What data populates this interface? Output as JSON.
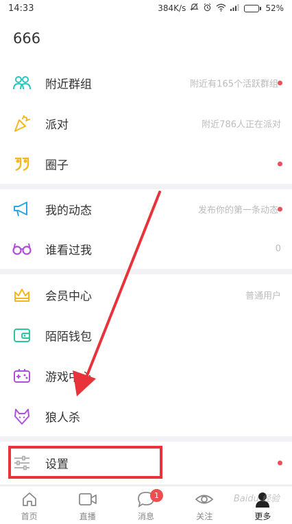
{
  "status_bar": {
    "time": "14:33",
    "speed": "384K/s",
    "battery": "52%",
    "battery_level": 0.52
  },
  "header": {
    "title": "666"
  },
  "sections": [
    [
      {
        "label": "附近群组",
        "hint": "附近有165个活跃群组",
        "dot": true,
        "icon": "group-icon",
        "color": "#2bc6c0"
      },
      {
        "label": "派对",
        "hint": "附近786人正在派对",
        "dot": false,
        "icon": "party-icon",
        "color": "#f5b81c"
      },
      {
        "label": "圈子",
        "hint": "",
        "dot": true,
        "icon": "circle-quote-icon",
        "color": "#f5b81c"
      }
    ],
    [
      {
        "label": "我的动态",
        "hint": "发布你的第一条动态",
        "dot": true,
        "icon": "megaphone-icon",
        "color": "#2aa6e0"
      },
      {
        "label": "谁看过我",
        "hint": "0",
        "dot": false,
        "icon": "glasses-icon",
        "color": "#b04fd9"
      }
    ],
    [
      {
        "label": "会员中心",
        "hint": "普通用户",
        "dot": false,
        "icon": "crown-icon",
        "color": "#f5b81c"
      },
      {
        "label": "陌陌钱包",
        "hint": "",
        "dot": false,
        "icon": "wallet-icon",
        "color": "#2bc6a0"
      },
      {
        "label": "游戏中心",
        "hint": "",
        "dot": false,
        "icon": "gamepad-icon",
        "color": "#b04fd9"
      },
      {
        "label": "狼人杀",
        "hint": "",
        "dot": false,
        "icon": "wolf-icon",
        "color": "#b04fd9"
      }
    ],
    [
      {
        "label": "设置",
        "hint": "",
        "dot": true,
        "icon": "settings-sliders-icon",
        "color": "#aaaaaa"
      }
    ]
  ],
  "tabbar": [
    {
      "label": "首页",
      "icon": "home-icon",
      "active": false,
      "badge": ""
    },
    {
      "label": "直播",
      "icon": "video-icon",
      "active": false,
      "badge": ""
    },
    {
      "label": "消息",
      "icon": "message-icon",
      "active": false,
      "badge": "1"
    },
    {
      "label": "关注",
      "icon": "eye-icon",
      "active": false,
      "badge": ""
    },
    {
      "label": "更多",
      "icon": "more-person-icon",
      "active": true,
      "badge": ""
    }
  ],
  "colors": {
    "accent_dot": "#e8505b",
    "highlight": "#e8333b",
    "badge": "#f04e4e"
  }
}
